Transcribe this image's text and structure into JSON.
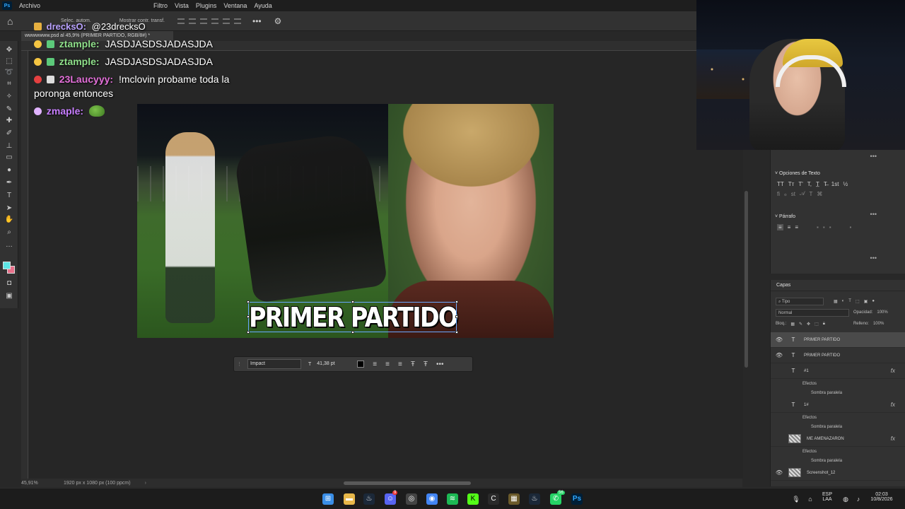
{
  "menu": {
    "items": [
      "Archivo",
      "Filtro",
      "Vista",
      "Plugins",
      "Ventana",
      "Ayuda"
    ]
  },
  "optionsbar": {
    "auto_select": "Selec. autom.",
    "show_transform": "Mostrar contr. transf."
  },
  "document": {
    "tab_title": "wwwwwww.psd al 45,9% (PRIMER PARTIDO, RGB/8#) *",
    "overlay_text": "PRIMER PARTIDO",
    "zoom": "45,91%",
    "dimensions": "1920 px x 1080 px (100 ppcm)"
  },
  "text_contextbar": {
    "font": "Impact",
    "size": "41,38 pt",
    "text_color": "#000000"
  },
  "chat": {
    "messages": [
      {
        "user": "drecksO:",
        "text": "@23drecksO",
        "color": "#b9a2ff"
      },
      {
        "user": "ztample:",
        "text": "JASDJASDSJADASJDA",
        "color": "#8fe08a"
      },
      {
        "user": "ztample:",
        "text": "JASDJASDSJADASJDA",
        "color": "#8fe08a"
      },
      {
        "user": "23Laucyyy:",
        "text": "!mclovin probame toda la poronga entonces",
        "color": "#e36fd9"
      },
      {
        "user": "zmaple:",
        "text": "",
        "color": "#c77dff"
      }
    ]
  },
  "properties": {
    "text_options_title": "Opciones de Texto",
    "paragraph_title": "Párrafo"
  },
  "layers": {
    "title": "Capas",
    "filter": "Tipo",
    "blend_mode": "Normal",
    "opacity_label": "Opacidad:",
    "opacity": "100%",
    "lock_label": "Bloq.:",
    "fill_label": "Relleno:",
    "fill": "100%",
    "effects_label": "Efectos",
    "shadow_label": "Sombra paralela",
    "items": [
      {
        "name": "PRIMER PARTIDO",
        "kind": "T",
        "visible": true,
        "selected": true
      },
      {
        "name": "PRIMER PARTIDO",
        "kind": "T",
        "visible": true
      },
      {
        "name": "#1",
        "kind": "T",
        "visible": false,
        "fx": true
      },
      {
        "name": "1#",
        "kind": "T",
        "visible": false,
        "fx": true
      },
      {
        "name": "ME AMENAZARON",
        "kind": "img",
        "visible": false,
        "fx": true
      },
      {
        "name": "Screenshot_12",
        "kind": "img",
        "visible": true
      }
    ]
  },
  "taskbar": {
    "lang_top": "ESP",
    "lang_bottom": "LAA",
    "time": "02:03",
    "date": "10/8/2026",
    "discord_badge": "9",
    "whatsapp_badge": "56"
  },
  "colors": {
    "accent": "#31a8ff",
    "foreground_swatch": "#5de5e5",
    "background_swatch": "#e8708a"
  }
}
